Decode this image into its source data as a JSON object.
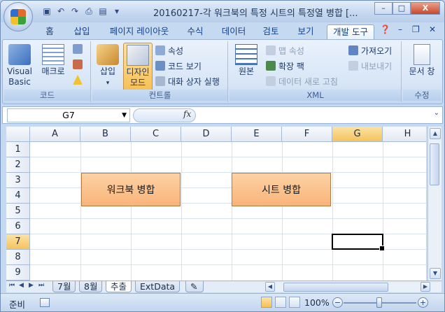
{
  "window": {
    "title": "20160217-각 워크북의 특정 시트의 특정열 병합 [...",
    "controls": [
      "–",
      "□",
      "X"
    ]
  },
  "ribbon_tabs": [
    "홈",
    "삽입",
    "페이지 레이아웃",
    "수식",
    "데이터",
    "검토",
    "보기",
    "개발 도구"
  ],
  "active_tab": "개발 도구",
  "ribbon": {
    "code": {
      "label": "코드",
      "visual_basic": "Visual Basic",
      "macro": "매크로"
    },
    "controls": {
      "label": "컨트롤",
      "insert": "삽입",
      "design_mode": "디자인 모드",
      "properties": "속성",
      "view_code": "코드 보기",
      "run_dialog": "대화 상자 실행"
    },
    "xml": {
      "label": "XML",
      "source": "원본",
      "map_properties": "맵 속성",
      "expansion_packs": "확장 팩",
      "refresh_data": "데이터 새로 고침",
      "import": "가져오기",
      "export": "내보내기"
    },
    "modify": {
      "label": "수정",
      "document_panel": "문서 창"
    }
  },
  "formula_bar": {
    "name_box": "G7",
    "fx": "fx",
    "value": ""
  },
  "sheet": {
    "columns": [
      "A",
      "B",
      "C",
      "D",
      "E",
      "F",
      "G",
      "H"
    ],
    "rows": [
      "1",
      "2",
      "3",
      "4",
      "5",
      "6",
      "7",
      "8",
      "9"
    ],
    "selected_cell": "G7",
    "buttons": {
      "merge_workbook": "워크북 병합",
      "merge_sheet": "시트 병합"
    }
  },
  "sheet_tabs": [
    "7월",
    "8월",
    "추출",
    "ExtData"
  ],
  "active_sheet": "추출",
  "status": {
    "ready": "준비",
    "zoom": "100%"
  },
  "colors": {
    "button_fill": "#f9b479",
    "selected_header": "#f5c35d",
    "ribbon_bg": "#d7e5f6"
  }
}
